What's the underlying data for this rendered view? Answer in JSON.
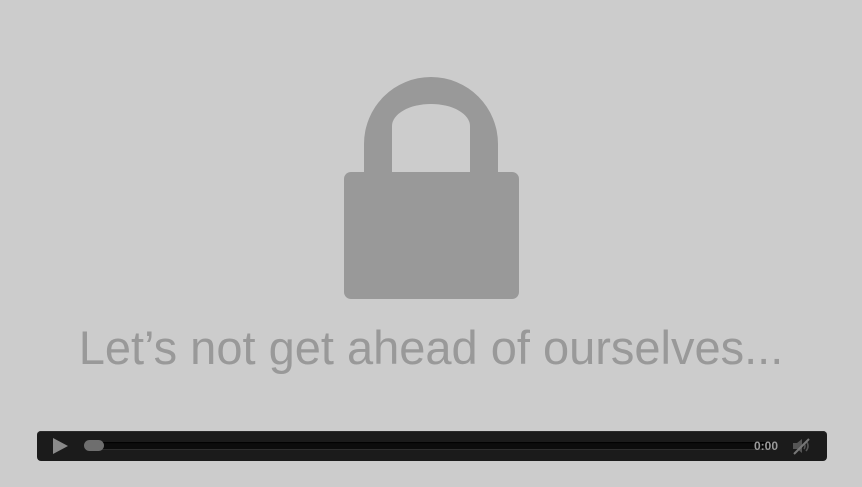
{
  "message": "Let’s not get ahead of ourselves...",
  "player": {
    "play_icon": "play-icon",
    "time": "0:00",
    "progress": 0,
    "mute_icon": "volume-muted-icon"
  },
  "colors": {
    "background": "#cccccc",
    "lock": "#999999",
    "text": "#999999",
    "player_bar": "#1b1b1b",
    "player_controls": "#8a8a8a"
  }
}
